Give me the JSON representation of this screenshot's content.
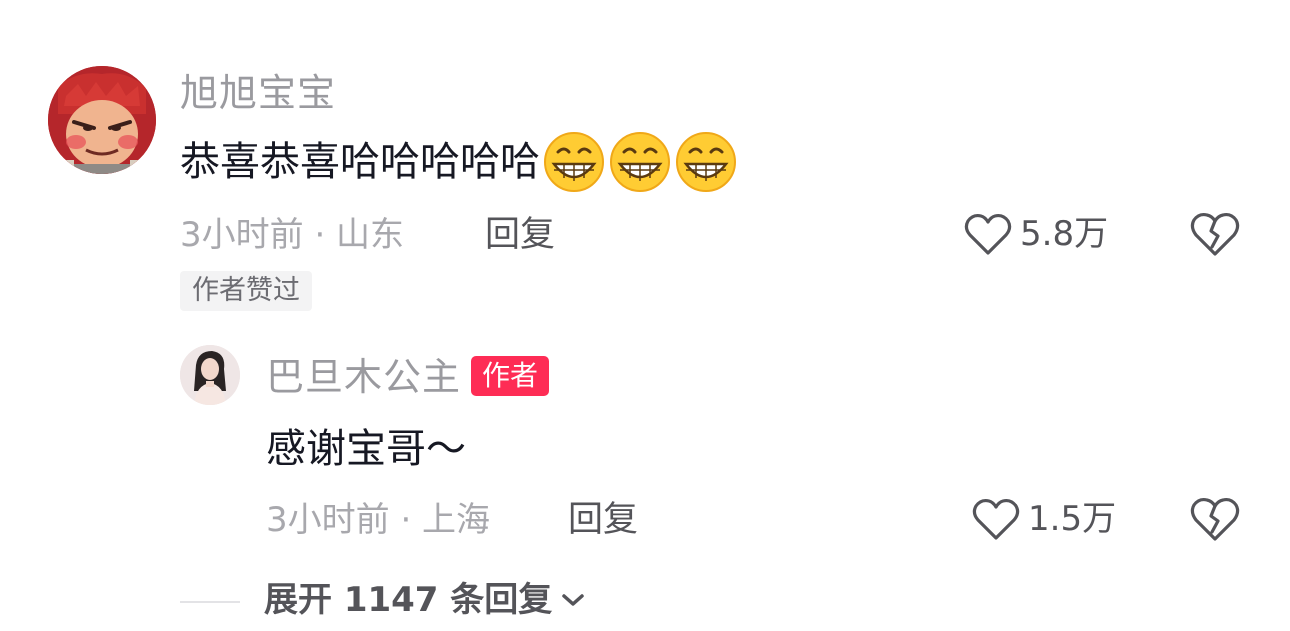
{
  "comment": {
    "username": "旭旭宝宝",
    "text": "恭喜恭喜哈哈哈哈哈",
    "emojis": [
      "grinning-face-icon",
      "grinning-face-icon",
      "grinning-face-icon"
    ],
    "meta": "3小时前 · 山东",
    "reply_label": "回复",
    "like_count": "5.8万",
    "author_liked_tag": "作者赞过"
  },
  "reply": {
    "username": "巴旦木公主",
    "author_badge": "作者",
    "text": "感谢宝哥～",
    "meta": "3小时前 · 上海",
    "reply_label": "回复",
    "like_count": "1.5万"
  },
  "expand": {
    "label": "展开 1147 条回复"
  },
  "colors": {
    "badge": "#fe2c55",
    "text_primary": "#161823",
    "text_secondary": "#a8a8ad"
  }
}
